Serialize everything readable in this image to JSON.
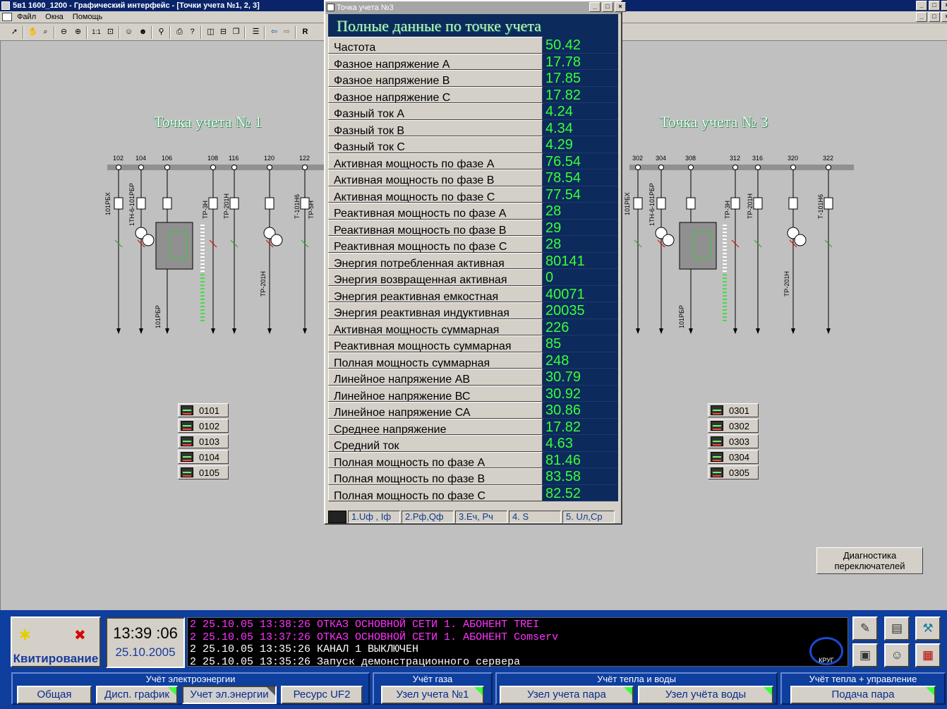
{
  "window": {
    "title": "5в1 1600_1200 - Графический интерфейс - [Точки учета №1, 2, 3]"
  },
  "menu": [
    "Файл",
    "Окна",
    "Помощь"
  ],
  "toolbar": {
    "zoom_label": "1:1",
    "r_label": "R"
  },
  "points": {
    "left": {
      "title": "Точка учета № 1",
      "bus_numbers": [
        "102",
        "104",
        "106",
        "108",
        "116",
        "120",
        "122"
      ],
      "labels": [
        "101РБХ",
        "1ТН-6-101РБР",
        "101РБР",
        "ТР-3Н",
        "ТР-201Н",
        "ТР-201Н",
        "Т-101Н6",
        "ТР-5Н"
      ],
      "devices": [
        "0101",
        "0102",
        "0103",
        "0104",
        "0105"
      ]
    },
    "right": {
      "title": "Точка учета № 3",
      "bus_numbers": [
        "302",
        "304",
        "308",
        "312",
        "316",
        "320",
        "322"
      ],
      "labels": [
        "101РБХ",
        "1ТН-6-101РБР",
        "101РБР",
        "ТР-3Н",
        "ТР-201Н",
        "ТР-201Н",
        "Т-101Н6"
      ],
      "devices": [
        "0301",
        "0302",
        "0303",
        "0304",
        "0305"
      ]
    }
  },
  "dialog": {
    "title": "Точка учета №3",
    "heading": "Полные данные по точке учета",
    "rows": [
      {
        "label": "Частота",
        "value": "50.42"
      },
      {
        "label": "Фазное напряжение А",
        "value": "17.78"
      },
      {
        "label": "Фазное напряжение В",
        "value": "17.85"
      },
      {
        "label": "Фазное напряжение С",
        "value": "17.82"
      },
      {
        "label": "Фазный ток А",
        "value": "4.24"
      },
      {
        "label": "Фазный ток В",
        "value": "4.34"
      },
      {
        "label": "Фазный ток С",
        "value": "4.29"
      },
      {
        "label": "Активная мощность по фазе А",
        "value": "76.54"
      },
      {
        "label": "Активная мощность по фазе В",
        "value": "78.54"
      },
      {
        "label": "Активная мощность по фазе С",
        "value": "77.54"
      },
      {
        "label": "Реактивная мощность по фазе А",
        "value": "28"
      },
      {
        "label": "Реактивная мощность по фазе В",
        "value": "29"
      },
      {
        "label": "Реактивная мощность по фазе С",
        "value": "28"
      },
      {
        "label": "Энергия потребленная активная",
        "value": "80141"
      },
      {
        "label": "Энергия возвращенная активная",
        "value": "0"
      },
      {
        "label": "Энергия реактивная емкостная",
        "value": "40071"
      },
      {
        "label": "Энергия реактивная индуктивная",
        "value": "20035"
      },
      {
        "label": "Активная мощность суммарная",
        "value": "226"
      },
      {
        "label": "Реактивная мощность суммарная",
        "value": "85"
      },
      {
        "label": "Полная мощность суммарная",
        "value": "248"
      },
      {
        "label": "Линейное напряжение АВ",
        "value": "30.79"
      },
      {
        "label": "Линейное напряжение ВС",
        "value": "30.92"
      },
      {
        "label": "Линейное напряжение СА",
        "value": "30.86"
      },
      {
        "label": "Среднее напряжение",
        "value": "17.82"
      },
      {
        "label": "Средний ток",
        "value": "4.63"
      },
      {
        "label": "Полная мощность по фазе А",
        "value": "81.46"
      },
      {
        "label": "Полная мощность по фазе В",
        "value": "83.58"
      },
      {
        "label": "Полная мощность по фазе С",
        "value": "82.52"
      }
    ],
    "tabs": [
      "1.Uф , Iф",
      "2.Рф,Qф",
      "3.Еч, Рч",
      "4. S",
      "5. Uл,Ср"
    ]
  },
  "diagnostics_button": "Диагностика переключателей",
  "ack": {
    "label": "Квитирование"
  },
  "clock": {
    "time": "13:39 :06",
    "date": "25.10.2005"
  },
  "log": [
    {
      "text": "2  25.10.05 13:38:26 ОТКАЗ ОСНОВНОЙ СЕТИ 1. АБОНЕНТ TREI",
      "color": "#ff33ff"
    },
    {
      "text": "2  25.10.05 13:37:26 ОТКАЗ ОСНОВНОЙ СЕТИ 1. АБОНЕНТ Comserv",
      "color": "#ff33ff"
    },
    {
      "text": "2  25.10.05 13:35:26 КАНАЛ 1 ВЫКЛЮЧЕН",
      "color": "#ffffff"
    },
    {
      "text": "2  25.10.05 13:35:26 Запуск демонстрационного сервера",
      "color": "#ffffff"
    }
  ],
  "log_logo": "КРУГ",
  "nav": {
    "electric": {
      "title": "Учёт электроэнергии",
      "buttons": [
        "Общая",
        "Дисп. график",
        "Учет эл.энергии",
        "Ресурс UF2"
      ]
    },
    "gas": {
      "title": "Учёт газа",
      "buttons": [
        "Узел учета №1"
      ]
    },
    "heat": {
      "title": "Учёт тепла и воды",
      "buttons": [
        "Узел учета пара",
        "Узел учёта воды"
      ]
    },
    "heatctl": {
      "title": "Учёт тепла + управление",
      "buttons": [
        "Подача пара"
      ]
    }
  },
  "colors": {
    "panel_dark": "#0c2a5c",
    "value_green": "#39ff39",
    "bottom_bg": "#0e3e9e"
  }
}
